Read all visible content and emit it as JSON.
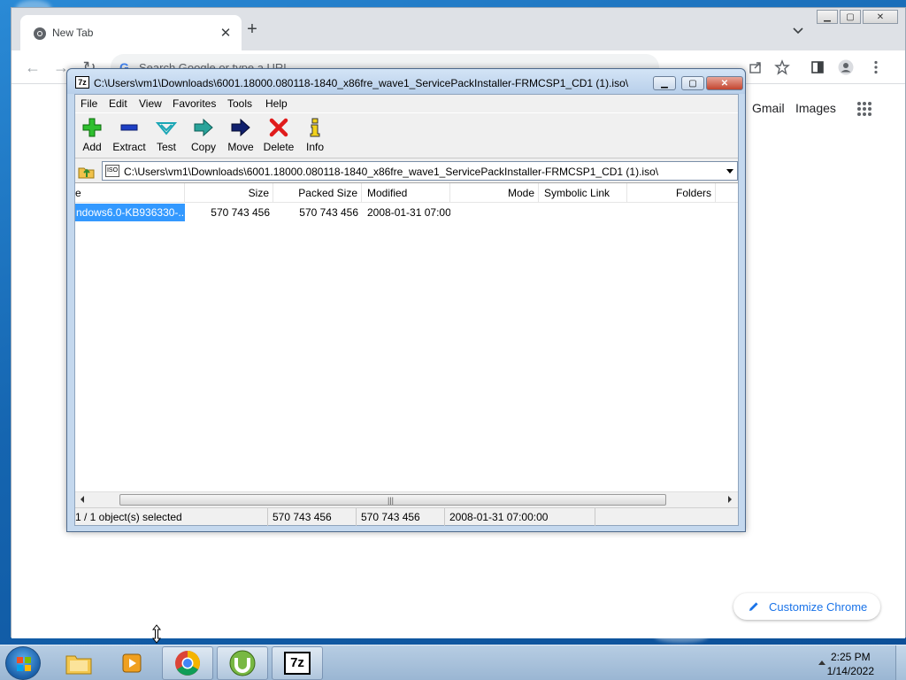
{
  "chrome": {
    "tab_title": "New Tab",
    "omnibox_placeholder": "Search Google or type a URL",
    "links": {
      "gmail": "Gmail",
      "images": "Images"
    },
    "customize_label": "Customize Chrome",
    "accent": "#1a73e8"
  },
  "sevenzip": {
    "title": "C:\\Users\\vm1\\Downloads\\6001.18000.080118-1840_x86fre_wave1_ServicePackInstaller-FRMCSP1_CD1 (1).iso\\",
    "app_icon_label": "7z",
    "menu": [
      "File",
      "Edit",
      "View",
      "Favorites",
      "Tools",
      "Help"
    ],
    "toolbar": [
      {
        "label": "Add",
        "icon": "plus-icon"
      },
      {
        "label": "Extract",
        "icon": "minus-icon"
      },
      {
        "label": "Test",
        "icon": "check-icon"
      },
      {
        "label": "Copy",
        "icon": "copy-arrow-icon"
      },
      {
        "label": "Move",
        "icon": "move-arrow-icon"
      },
      {
        "label": "Delete",
        "icon": "delete-x-icon"
      },
      {
        "label": "Info",
        "icon": "info-icon"
      }
    ],
    "path": "C:\\Users\\vm1\\Downloads\\6001.18000.080118-1840_x86fre_wave1_ServicePackInstaller-FRMCSP1_CD1 (1).iso\\",
    "path_icon_label": "ISO",
    "columns": [
      "e",
      "Size",
      "Packed Size",
      "Modified",
      "Mode",
      "Symbolic Link",
      "Folders"
    ],
    "rows": [
      {
        "name": "ndows6.0-KB936330-...",
        "size": "570 743 456",
        "packed": "570 743 456",
        "modified": "2008-01-31 07:00",
        "mode": "",
        "symlink": "",
        "folders": ""
      }
    ],
    "status": {
      "selected": "1 / 1 object(s) selected",
      "size": "570 743 456",
      "packed": "570 743 456",
      "modified": "2008-01-31 07:00:00"
    },
    "selection_color": "#3399ff"
  },
  "taskbar": {
    "time": "2:25 PM",
    "date": "1/14/2022",
    "items": [
      "explorer-icon",
      "media-player-icon",
      "chrome-icon",
      "utorrent-icon",
      "7zip-icon"
    ],
    "sevenzip_label": "7z"
  }
}
